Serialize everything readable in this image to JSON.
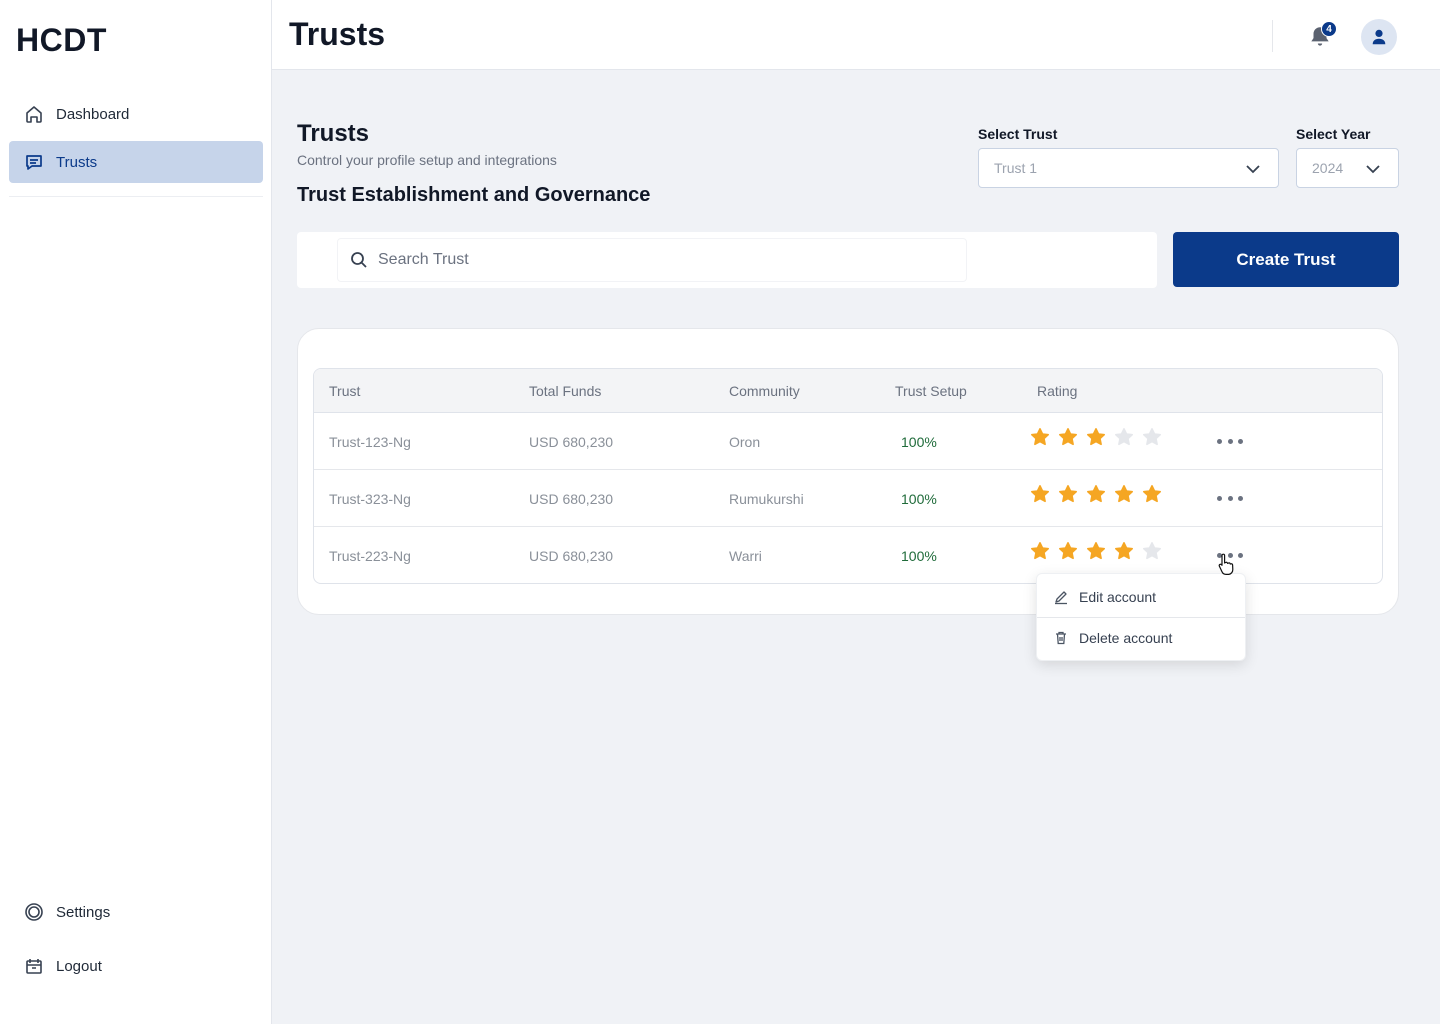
{
  "app": {
    "logo": "HCDT"
  },
  "sidebar": {
    "items": [
      {
        "label": "Dashboard",
        "icon": "home-icon",
        "active": false
      },
      {
        "label": "Trusts",
        "icon": "message-square-icon",
        "active": true
      }
    ],
    "bottom": [
      {
        "label": "Settings",
        "icon": "gear-icon"
      },
      {
        "label": "Logout",
        "icon": "logout-box-icon"
      }
    ]
  },
  "topbar": {
    "title": "Trusts",
    "notification_count": "4"
  },
  "header": {
    "title": "Trusts",
    "subtitle": "Control your profile setup and integrations",
    "section_title": "Trust Establishment and Governance"
  },
  "filters": {
    "trust": {
      "label": "Select Trust",
      "value": "Trust 1"
    },
    "year": {
      "label": "Select Year",
      "value": "2024"
    }
  },
  "search": {
    "placeholder": "Search Trust"
  },
  "actions": {
    "create_label": "Create Trust"
  },
  "table": {
    "columns": [
      "Trust",
      "Total Funds",
      "Community",
      "Trust Setup",
      "Rating"
    ],
    "rows": [
      {
        "trust": "Trust-123-Ng",
        "funds": "USD 680,230",
        "community": "Oron",
        "setup": "100%",
        "rating": 3
      },
      {
        "trust": "Trust-323-Ng",
        "funds": "USD 680,230",
        "community": "Rumukurshi",
        "setup": "100%",
        "rating": 5
      },
      {
        "trust": "Trust-223-Ng",
        "funds": "USD 680,230",
        "community": "Warri",
        "setup": "100%",
        "rating": 4
      }
    ]
  },
  "context_menu": {
    "edit_label": "Edit account",
    "delete_label": "Delete account"
  },
  "colors": {
    "primary": "#0b3a8a",
    "active_nav_bg": "#c6d4ea",
    "star_filled": "#f5a623",
    "star_empty": "#e5e7eb",
    "setup_green": "#1f6b3a"
  }
}
